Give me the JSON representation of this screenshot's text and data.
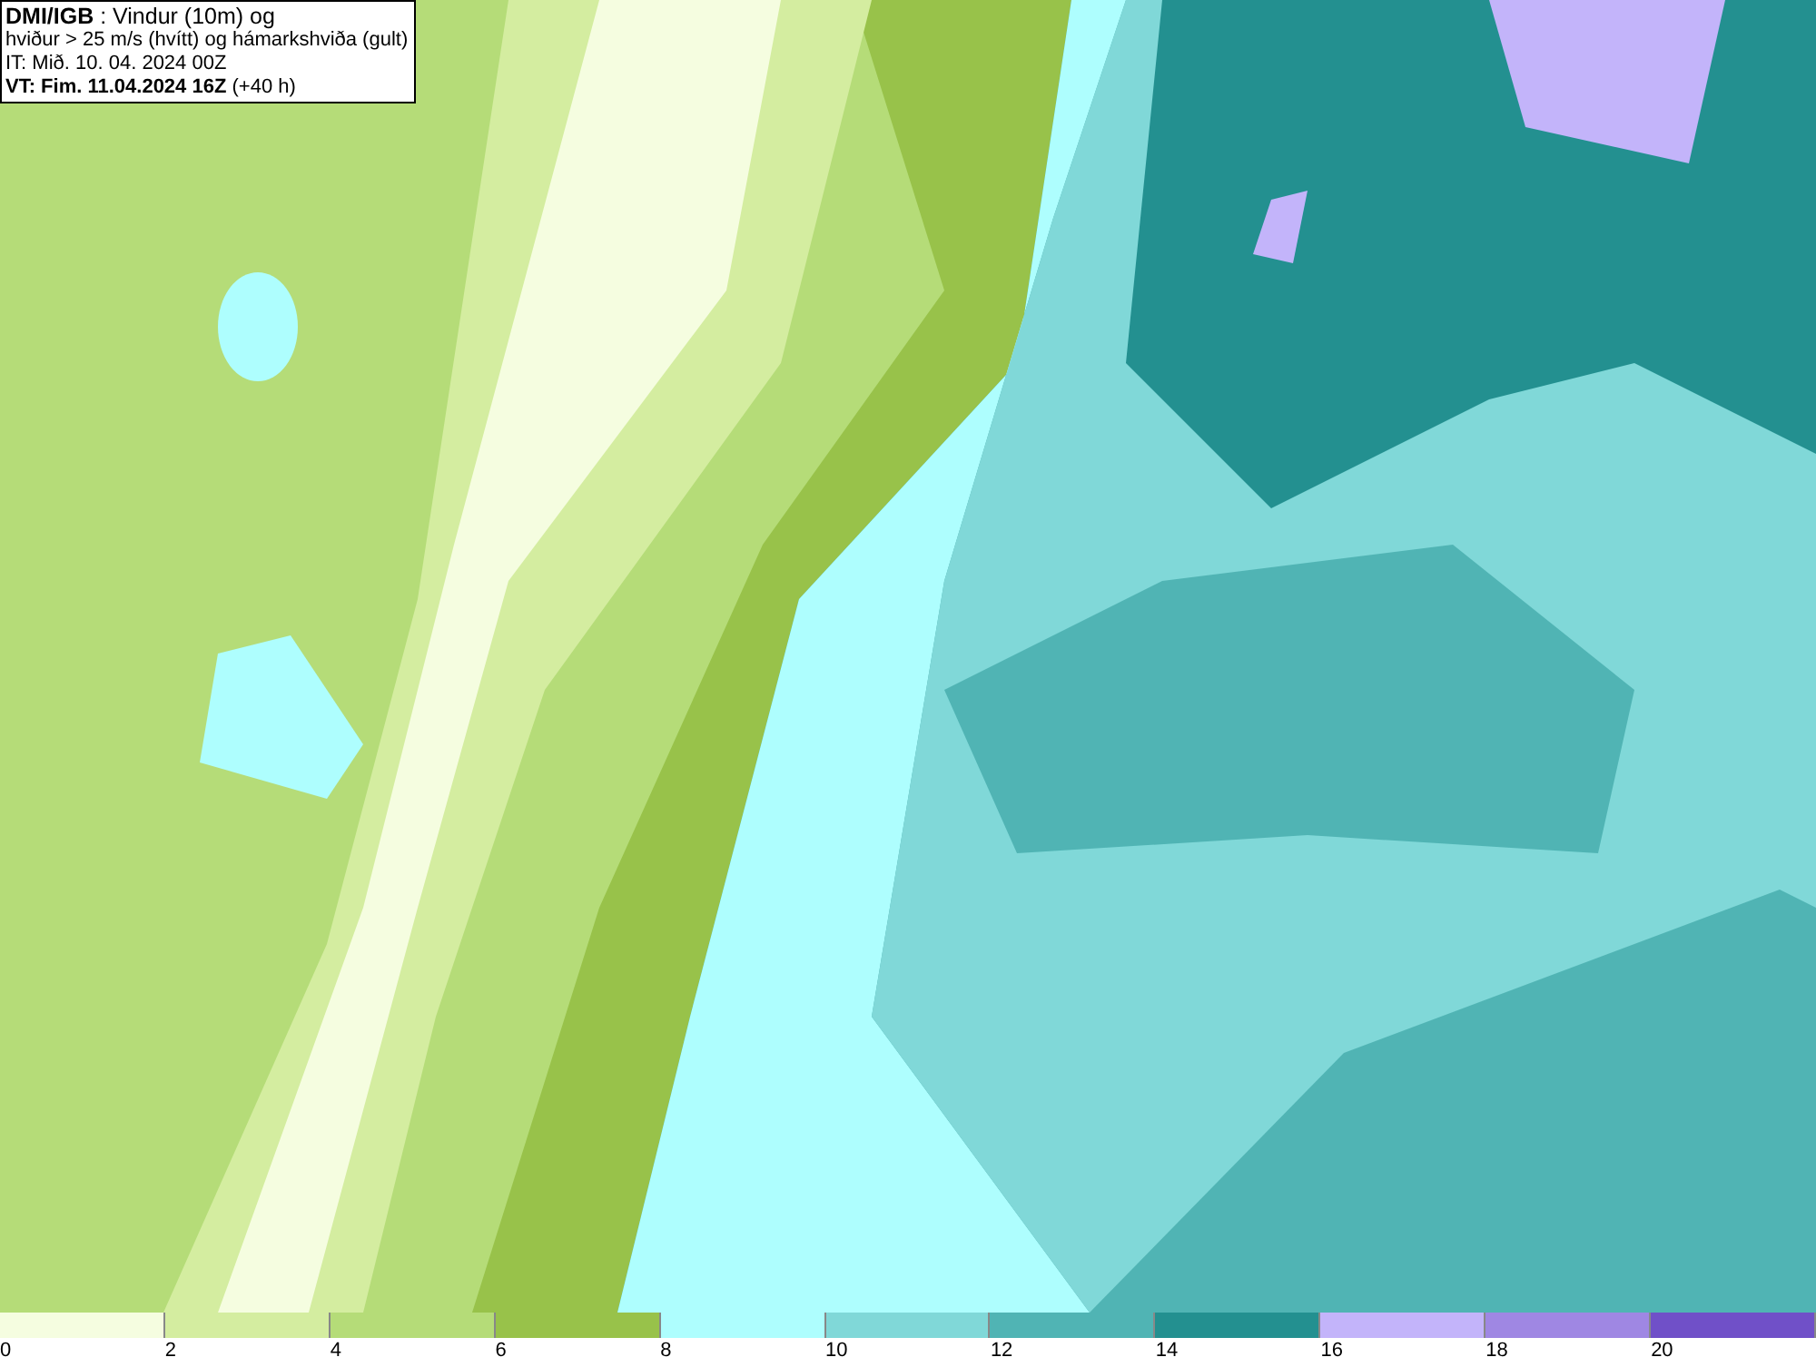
{
  "header": {
    "lines": [
      "**DMI/IGB** : Vindur (10m) og",
      "hviður > 25 m/s (hvítt) og hámarkshviða (gult)",
      "IT: Mið. 10. 04. 2024 00Z",
      "**VT: Fim. 11.04.2024 16Z** (+40 h)"
    ]
  },
  "legend": {
    "bins": [
      {
        "label": "0",
        "color": "#f5fde0"
      },
      {
        "label": "2",
        "color": "#d4eda0"
      },
      {
        "label": "4",
        "color": "#b5dc78"
      },
      {
        "label": "6",
        "color": "#98c24a"
      },
      {
        "label": "8",
        "color": "#aefefe"
      },
      {
        "label": "10",
        "color": "#80d8d8"
      },
      {
        "label": "12",
        "color": "#50b4b4"
      },
      {
        "label": "14",
        "color": "#239090"
      },
      {
        "label": "16",
        "color": "#c3b4fa"
      },
      {
        "label": "18",
        "color": "#9f87e3"
      },
      {
        "label": "20",
        "color": "#7050c8"
      }
    ]
  }
}
